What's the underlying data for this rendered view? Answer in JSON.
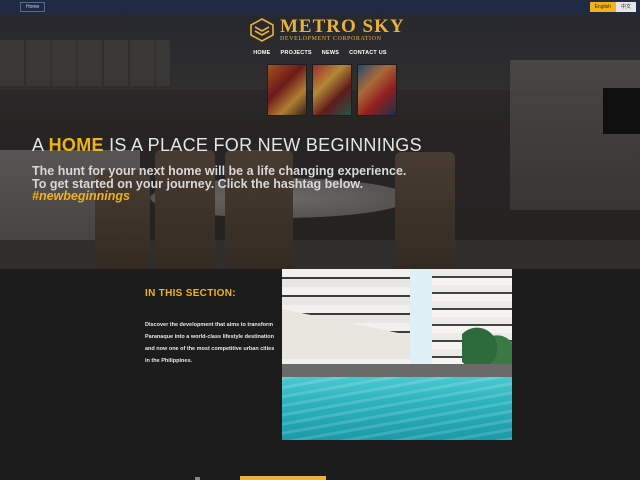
{
  "topbar": {
    "home_tab": "Home",
    "lang_en": "English",
    "lang_zh": "中文"
  },
  "logo": {
    "name": "METRO SKY",
    "subtitle": "DEVELOPMENT CORPORATION"
  },
  "nav": {
    "items": [
      "HOME",
      "PROJECTS",
      "NEWS",
      "CONTACT US"
    ]
  },
  "hero": {
    "headline_pre": "A ",
    "headline_highlight": "HOME",
    "headline_post": " IS A PLACE FOR NEW BEGINNINGS",
    "line1": "The hunt for your next home will be a life changing experience.",
    "line2": "To get started on your journey. Click the hashtag below.",
    "hashtag": "#newbeginnings"
  },
  "section": {
    "title": "IN THIS SECTION:",
    "body": "Discover the development that aims to transform Paranaque into a world-class lifestyle destination and now one of the most competitive urban cities in the Philippines."
  },
  "colors": {
    "accent": "#f2b21b",
    "topbar": "#1f2a44",
    "section_bg": "#1c1c1c"
  }
}
